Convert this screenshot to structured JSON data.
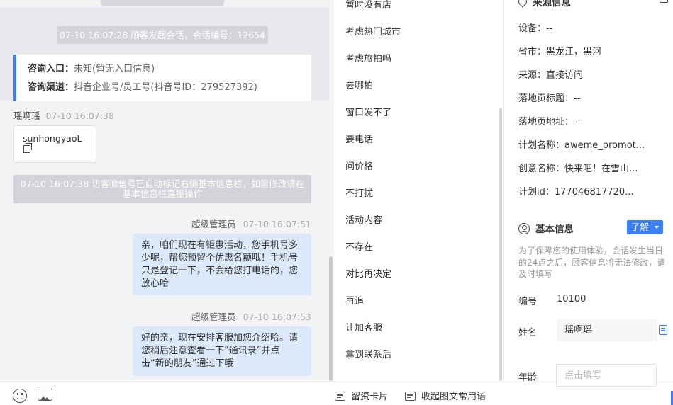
{
  "chat": {
    "session_notice": "07-10 16:07:28 顾客发起会话，会话编号：12654",
    "entry_label": "咨询入口：",
    "entry_value": "未知(暂无入口信息)",
    "channel_label": "咨询渠道：",
    "channel_value": "抖音企业号/员工号(抖音号ID：279527392)",
    "customer_name": "瑶啊瑶",
    "customer_time": "07-10 16:07:38",
    "customer_msg": "sunhongyaoL",
    "wechat_notice": "07-10 16:07:38 访客微信号已自动标记右侧基本信息栏，如需修改请在基本信息栏直接操作",
    "agent_name": "超级管理员",
    "agent_time_1": "07-10 16:07:51",
    "agent_msg_1": "亲，咱们现在有钜惠活动，您手机号多少呢，帮您预留个优惠名额哦！手机号只是登记一下，不会给您打电话的，您放心哈",
    "agent_time_2": "07-10 16:07:53",
    "agent_msg_2": "好的亲，现在安排客服加您介绍哈。请您稍后注意查看一下“通讯录”并点击“新的朋友”通过下哦"
  },
  "quick_replies": [
    "暂时没有店",
    "考虑热门城市",
    "考虑旅拍吗",
    "去哪拍",
    "窗口发不了",
    "要电话",
    "问价格",
    "不打扰",
    "活动内容",
    "不存在",
    "对比再决定",
    "再追",
    "让加客服",
    "拿到联系后"
  ],
  "bottom_bar": {
    "card_label": "留资卡片",
    "collapse_label": "收起图文常用语"
  },
  "info": {
    "source_title": "来源信息",
    "rows": [
      {
        "label": "设备：",
        "value": "--"
      },
      {
        "label": "省市：",
        "value": "黑龙江，黑河"
      },
      {
        "label": "来源：",
        "value": "直接访问"
      },
      {
        "label": "落地页标题：",
        "value": "--"
      },
      {
        "label": "落地页地址：",
        "value": "--"
      },
      {
        "label": "计划名称：",
        "value": "aweme_promot..."
      },
      {
        "label": "创意名称：",
        "value": "快来吧！在雪山..."
      },
      {
        "label": "计划id：",
        "value": "177046817720..."
      }
    ],
    "basic_title": "基本信息",
    "learn_more": "了解",
    "hint": "为了保障您的使用体验，会话发生当日的24点之后，顾客信息将无法修改，请及时填写",
    "id_label": "编号",
    "id_value": "10100",
    "name_label": "姓名",
    "name_value": "瑶啊瑶",
    "age_label": "年龄",
    "age_placeholder": "点击填写"
  },
  "colors": {
    "accent": "#3d7ff5",
    "agent_bubble": "#dce9fb",
    "chat_bg": "#f2f3f5",
    "notice_bg": "#d2d4d8"
  }
}
